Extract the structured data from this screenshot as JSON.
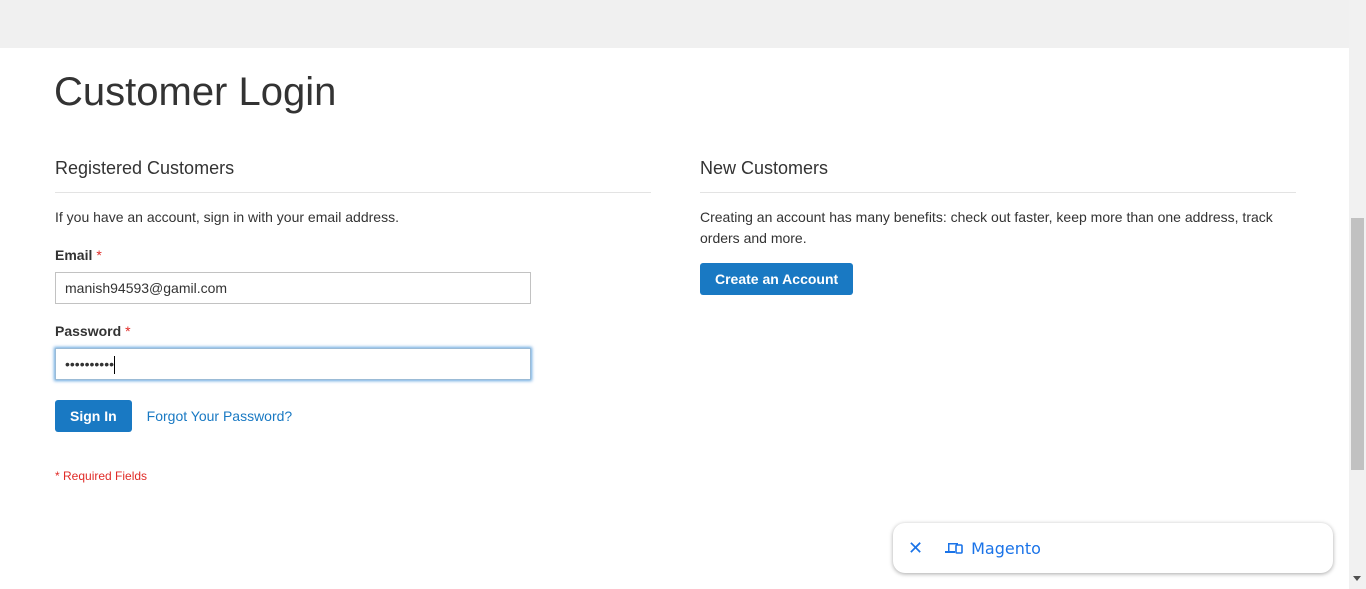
{
  "page": {
    "title": "Customer Login"
  },
  "registered": {
    "heading": "Registered Customers",
    "intro": "If you have an account, sign in with your email address.",
    "email_label": "Email",
    "email_value": "manish94593@gamil.com",
    "password_label": "Password",
    "password_value": "••••••••••",
    "required_mark": "*",
    "sign_in": "Sign In",
    "forgot": "Forgot Your Password?",
    "required_fields": "* Required Fields"
  },
  "new": {
    "heading": "New Customers",
    "text": "Creating an account has many benefits: check out faster, keep more than one address, track orders and more.",
    "create": "Create an Account"
  },
  "toast": {
    "label": "Magento",
    "close_icon": "close-icon",
    "device_icon": "devices-icon"
  },
  "colors": {
    "accent": "#1979c3",
    "required": "#e02b27",
    "toast": "#1a73e8"
  }
}
